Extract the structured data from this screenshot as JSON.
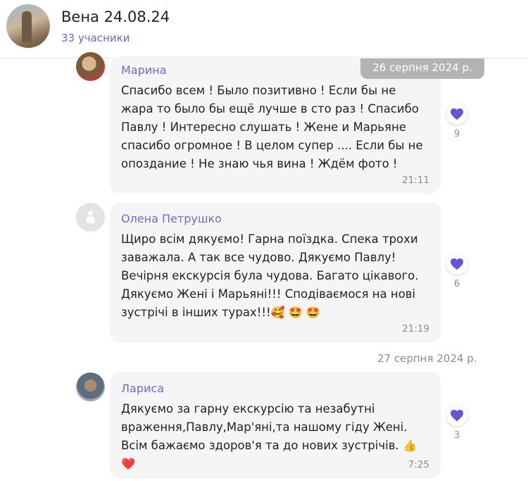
{
  "chat": {
    "title": "Вена 24.08.24",
    "members": "33 учасники"
  },
  "dates": {
    "first": "26 серпня 2024 р.",
    "second": "27 серпня 2024 р."
  },
  "messages": [
    {
      "author": "Марина",
      "text": "Спасибо всем ! Было позитивно ! Если бы не жара то было бы ещё лучше в сто раз ! Спасибо Павлу ! Интересно слушать ! Жене и Марьяне спасибо огромное ! В целом супер .... Если бы не опоздание ! Не знаю чья вина ! Ждём фото !",
      "time": "21:11",
      "reaction_count": "9"
    },
    {
      "author": "Олена Петрушко",
      "text": "Щиро всім дякуємо! Гарна поїздка. Спека трохи заважала. А так все чудово. Дякуємо Павлу! Вечірня екскурсія була чудова. Багато цікавого. Дякуємо Жені і Марьяні!!! Сподіваємося на нові зустрічі в інших турах!!!",
      "emoji": "🥰 🤩 🤩",
      "time": "21:19",
      "reaction_count": "6"
    },
    {
      "author": "Лариса",
      "text": "Дякуємо за гарну екскурсію та незабутні враження,Павлу,Мар'яні,та нашому гіду Жені. Всім бажаємо здоров'я та до нових зустрічів.",
      "emoji": "👍 ❤️",
      "time": "7:25",
      "reaction_count": "3"
    }
  ],
  "colors": {
    "accent": "#7a63c9",
    "heart": "#6b52d6",
    "bubble": "#f5f5f5",
    "date_pill": "#b3b3b3"
  },
  "icons": {
    "reaction": "heart-icon",
    "default_avatar": "person-icon"
  }
}
